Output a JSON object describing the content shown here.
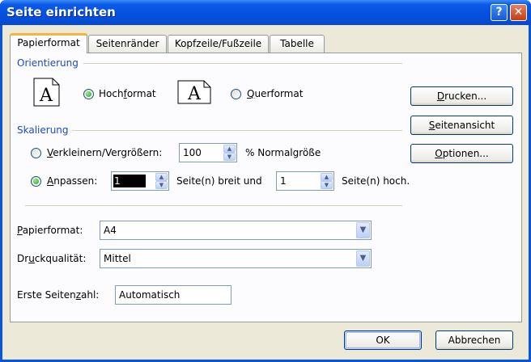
{
  "window": {
    "title": "Seite einrichten",
    "help_glyph": "?",
    "close_glyph": "✕"
  },
  "tabs": [
    "Papierformat",
    "Seitenränder",
    "Kopfzeile/Fußzeile",
    "Tabelle"
  ],
  "orientation": {
    "group_label": "Orientierung",
    "portrait_label_pre": "Hoch",
    "portrait_label_u": "f",
    "portrait_label_post": "ormat",
    "landscape_label_pre": "",
    "landscape_label_u": "Q",
    "landscape_label_post": "uerformat",
    "selected": "Hochformat",
    "icon_letter": "A"
  },
  "scaling": {
    "group_label": "Skalierung",
    "reduce_pre": "",
    "reduce_u": "V",
    "reduce_post": "erkleinern/Vergrößern:",
    "reduce_value": "100",
    "reduce_suffix": "% Normalgröße",
    "fit_pre": "",
    "fit_u": "A",
    "fit_post": "npassen:",
    "fit_wide_value": "1",
    "fit_wide_suffix": "Seite(n) breit und",
    "fit_tall_value": "1",
    "fit_tall_suffix": "Seite(n) hoch.",
    "selected": "Anpassen"
  },
  "paper": {
    "size_pre": "",
    "size_u": "P",
    "size_post": "apierformat:",
    "size_value": "A4",
    "quality_pre": "Dr",
    "quality_u": "u",
    "quality_post": "ckqualität:",
    "quality_value": "Mittel",
    "first_page_pre": "Erste Seiten",
    "first_page_u": "z",
    "first_page_post": "ahl:",
    "first_page_value": "Automatisch"
  },
  "side_buttons": {
    "print_u": "D",
    "print_post": "rucken...",
    "preview_u": "S",
    "preview_post": "eitenansicht",
    "options_u": "O",
    "options_post": "ptionen..."
  },
  "footer": {
    "ok": "OK",
    "cancel": "Abbrechen"
  }
}
